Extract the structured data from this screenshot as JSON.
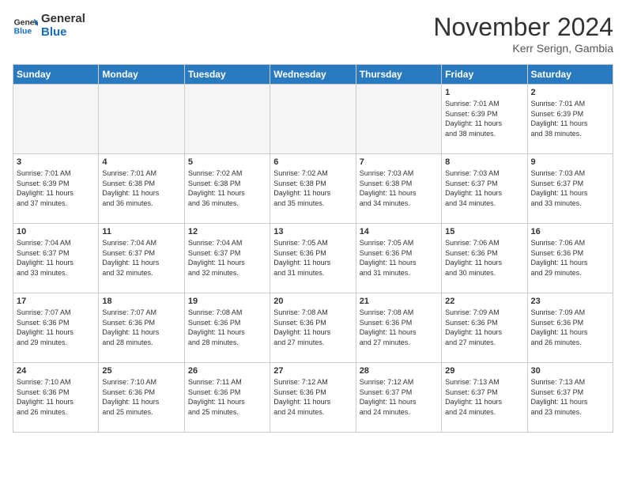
{
  "logo": {
    "line1": "General",
    "line2": "Blue"
  },
  "title": "November 2024",
  "location": "Kerr Serign, Gambia",
  "days_header": [
    "Sunday",
    "Monday",
    "Tuesday",
    "Wednesday",
    "Thursday",
    "Friday",
    "Saturday"
  ],
  "weeks": [
    [
      {
        "day": "",
        "info": "",
        "empty": true
      },
      {
        "day": "",
        "info": "",
        "empty": true
      },
      {
        "day": "",
        "info": "",
        "empty": true
      },
      {
        "day": "",
        "info": "",
        "empty": true
      },
      {
        "day": "",
        "info": "",
        "empty": true
      },
      {
        "day": "1",
        "info": "Sunrise: 7:01 AM\nSunset: 6:39 PM\nDaylight: 11 hours\nand 38 minutes."
      },
      {
        "day": "2",
        "info": "Sunrise: 7:01 AM\nSunset: 6:39 PM\nDaylight: 11 hours\nand 38 minutes."
      }
    ],
    [
      {
        "day": "3",
        "info": "Sunrise: 7:01 AM\nSunset: 6:39 PM\nDaylight: 11 hours\nand 37 minutes."
      },
      {
        "day": "4",
        "info": "Sunrise: 7:01 AM\nSunset: 6:38 PM\nDaylight: 11 hours\nand 36 minutes."
      },
      {
        "day": "5",
        "info": "Sunrise: 7:02 AM\nSunset: 6:38 PM\nDaylight: 11 hours\nand 36 minutes."
      },
      {
        "day": "6",
        "info": "Sunrise: 7:02 AM\nSunset: 6:38 PM\nDaylight: 11 hours\nand 35 minutes."
      },
      {
        "day": "7",
        "info": "Sunrise: 7:03 AM\nSunset: 6:38 PM\nDaylight: 11 hours\nand 34 minutes."
      },
      {
        "day": "8",
        "info": "Sunrise: 7:03 AM\nSunset: 6:37 PM\nDaylight: 11 hours\nand 34 minutes."
      },
      {
        "day": "9",
        "info": "Sunrise: 7:03 AM\nSunset: 6:37 PM\nDaylight: 11 hours\nand 33 minutes."
      }
    ],
    [
      {
        "day": "10",
        "info": "Sunrise: 7:04 AM\nSunset: 6:37 PM\nDaylight: 11 hours\nand 33 minutes."
      },
      {
        "day": "11",
        "info": "Sunrise: 7:04 AM\nSunset: 6:37 PM\nDaylight: 11 hours\nand 32 minutes."
      },
      {
        "day": "12",
        "info": "Sunrise: 7:04 AM\nSunset: 6:37 PM\nDaylight: 11 hours\nand 32 minutes."
      },
      {
        "day": "13",
        "info": "Sunrise: 7:05 AM\nSunset: 6:36 PM\nDaylight: 11 hours\nand 31 minutes."
      },
      {
        "day": "14",
        "info": "Sunrise: 7:05 AM\nSunset: 6:36 PM\nDaylight: 11 hours\nand 31 minutes."
      },
      {
        "day": "15",
        "info": "Sunrise: 7:06 AM\nSunset: 6:36 PM\nDaylight: 11 hours\nand 30 minutes."
      },
      {
        "day": "16",
        "info": "Sunrise: 7:06 AM\nSunset: 6:36 PM\nDaylight: 11 hours\nand 29 minutes."
      }
    ],
    [
      {
        "day": "17",
        "info": "Sunrise: 7:07 AM\nSunset: 6:36 PM\nDaylight: 11 hours\nand 29 minutes."
      },
      {
        "day": "18",
        "info": "Sunrise: 7:07 AM\nSunset: 6:36 PM\nDaylight: 11 hours\nand 28 minutes."
      },
      {
        "day": "19",
        "info": "Sunrise: 7:08 AM\nSunset: 6:36 PM\nDaylight: 11 hours\nand 28 minutes."
      },
      {
        "day": "20",
        "info": "Sunrise: 7:08 AM\nSunset: 6:36 PM\nDaylight: 11 hours\nand 27 minutes."
      },
      {
        "day": "21",
        "info": "Sunrise: 7:08 AM\nSunset: 6:36 PM\nDaylight: 11 hours\nand 27 minutes."
      },
      {
        "day": "22",
        "info": "Sunrise: 7:09 AM\nSunset: 6:36 PM\nDaylight: 11 hours\nand 27 minutes."
      },
      {
        "day": "23",
        "info": "Sunrise: 7:09 AM\nSunset: 6:36 PM\nDaylight: 11 hours\nand 26 minutes."
      }
    ],
    [
      {
        "day": "24",
        "info": "Sunrise: 7:10 AM\nSunset: 6:36 PM\nDaylight: 11 hours\nand 26 minutes."
      },
      {
        "day": "25",
        "info": "Sunrise: 7:10 AM\nSunset: 6:36 PM\nDaylight: 11 hours\nand 25 minutes."
      },
      {
        "day": "26",
        "info": "Sunrise: 7:11 AM\nSunset: 6:36 PM\nDaylight: 11 hours\nand 25 minutes."
      },
      {
        "day": "27",
        "info": "Sunrise: 7:12 AM\nSunset: 6:36 PM\nDaylight: 11 hours\nand 24 minutes."
      },
      {
        "day": "28",
        "info": "Sunrise: 7:12 AM\nSunset: 6:37 PM\nDaylight: 11 hours\nand 24 minutes."
      },
      {
        "day": "29",
        "info": "Sunrise: 7:13 AM\nSunset: 6:37 PM\nDaylight: 11 hours\nand 24 minutes."
      },
      {
        "day": "30",
        "info": "Sunrise: 7:13 AM\nSunset: 6:37 PM\nDaylight: 11 hours\nand 23 minutes."
      }
    ]
  ]
}
